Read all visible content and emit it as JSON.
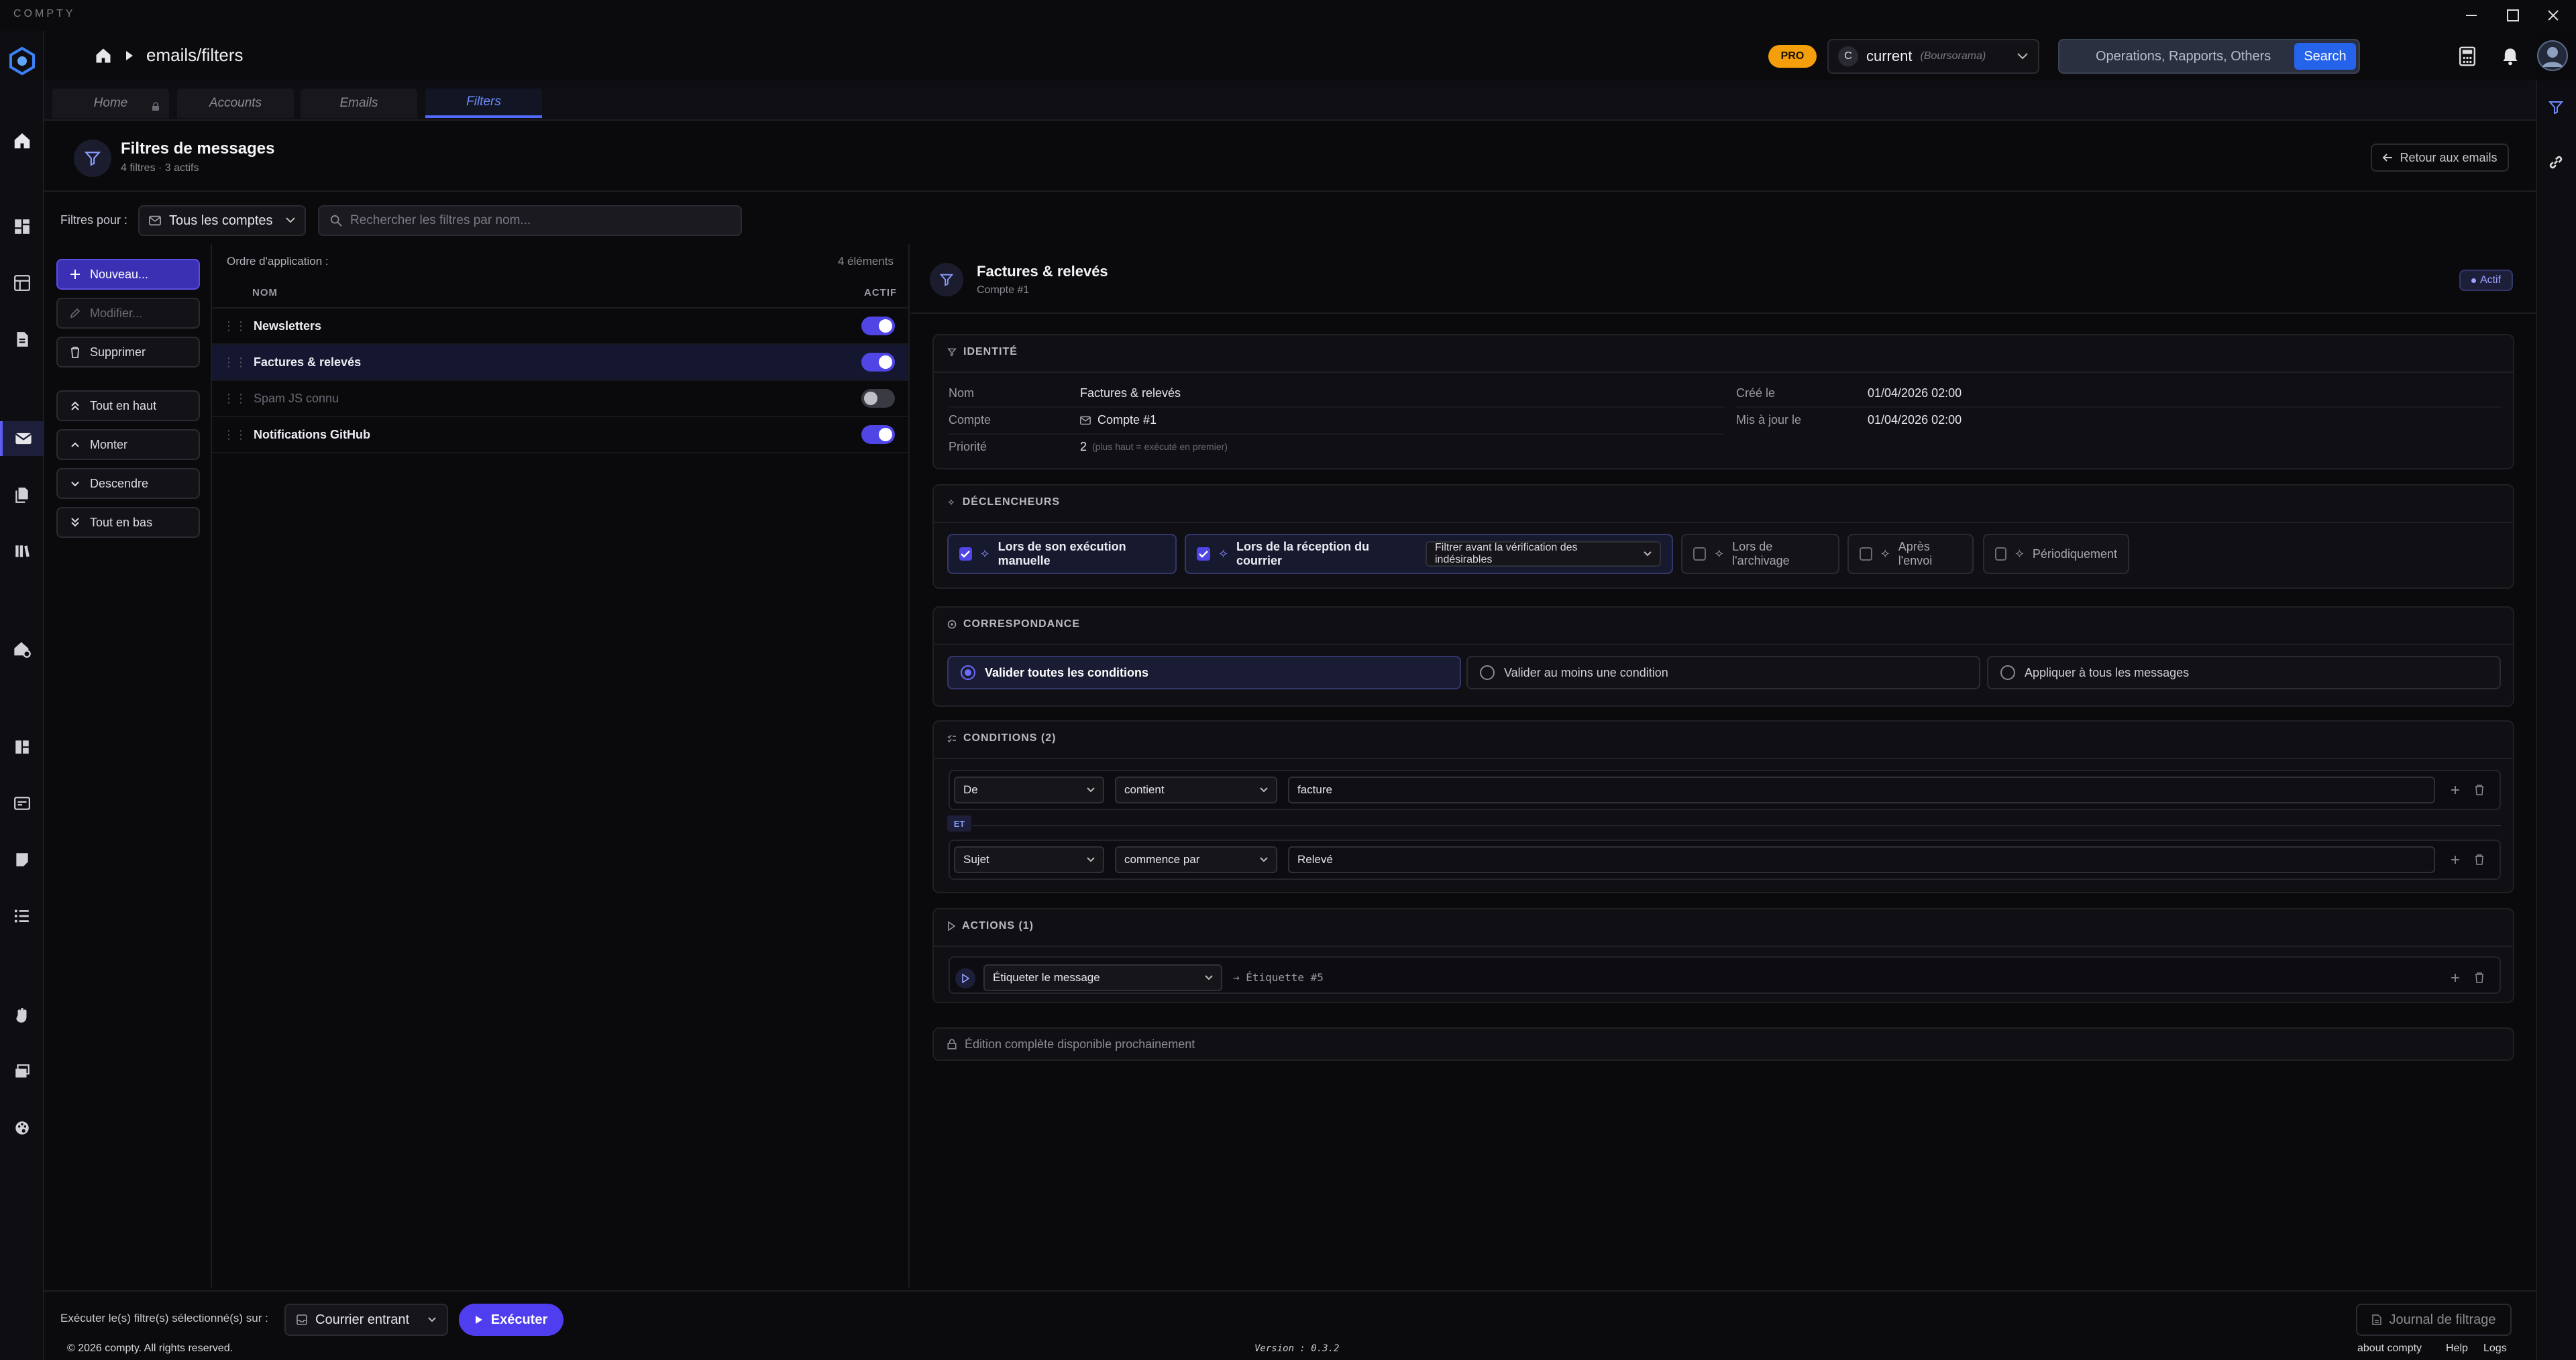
{
  "app": {
    "name": "COMPTY"
  },
  "header": {
    "breadcrumb": "emails/filters",
    "pro_badge": "PRO",
    "account_initial": "C",
    "account_name": "current",
    "account_sub": "(Boursorama)",
    "search_placeholder": "Operations, Rapports, Others",
    "search_button": "Search"
  },
  "tabs": [
    {
      "label": "Home"
    },
    {
      "label": "Accounts"
    },
    {
      "label": "Emails"
    },
    {
      "label": "Filters"
    }
  ],
  "page": {
    "title": "Filtres de messages",
    "subtitle": "4 filtres · 3 actifs",
    "back_button": "Retour aux emails"
  },
  "filterbar": {
    "label": "Filtres pour :",
    "account_select": "Tous les comptes",
    "search_placeholder": "Rechercher les filtres par nom..."
  },
  "actions": {
    "new": "Nouveau...",
    "edit": "Modifier...",
    "delete": "Supprimer",
    "top": "Tout en haut",
    "up": "Monter",
    "down": "Descendre",
    "bottom": "Tout en bas"
  },
  "list": {
    "order_label": "Ordre d'application :",
    "count": "4 éléments",
    "col_name": "NOM",
    "col_active": "ACTIF",
    "rows": [
      {
        "name": "Newsletters",
        "active": true
      },
      {
        "name": "Factures & relevés",
        "active": true
      },
      {
        "name": "Spam JS connu",
        "active": false
      },
      {
        "name": "Notifications GitHub",
        "active": true
      }
    ]
  },
  "detail": {
    "title": "Factures & relevés",
    "subtitle": "Compte #1",
    "status": "Actif",
    "identity": {
      "section": "IDENTITÉ",
      "name_label": "Nom",
      "name_value": "Factures & relevés",
      "account_label": "Compte",
      "account_value": "Compte #1",
      "priority_label": "Priorité",
      "priority_value": "2",
      "priority_hint": "(plus haut = exécuté en premier)",
      "created_label": "Créé le",
      "created_value": "01/04/2026 02:00",
      "updated_label": "Mis à jour le",
      "updated_value": "01/04/2026 02:00"
    },
    "triggers": {
      "section": "DÉCLENCHEURS",
      "manual": "Lors de son exécution manuelle",
      "receive": "Lors de la réception du courrier",
      "receive_option": "Filtrer avant la vérification des indésirables",
      "archive": "Lors de l'archivage",
      "send": "Après l'envoi",
      "periodic": "Périodiquement"
    },
    "matching": {
      "section": "CORRESPONDANCE",
      "all": "Valider toutes les conditions",
      "any": "Valider au moins une condition",
      "every": "Appliquer à tous les messages"
    },
    "conditions": {
      "section": "CONDITIONS (2)",
      "joiner": "ET",
      "items": [
        {
          "field": "De",
          "operator": "contient",
          "value": "facture"
        },
        {
          "field": "Sujet",
          "operator": "commence par",
          "value": "Relevé"
        }
      ]
    },
    "actions_section": {
      "section": "ACTIONS (1)",
      "action": "Étiqueter le message",
      "target": "→ Étiquette #5"
    },
    "notice": "Édition complète disponible prochainement"
  },
  "bottom": {
    "run_label": "Exécuter le(s) filtre(s) sélectionné(s) sur :",
    "run_select": "Courrier entrant",
    "run_button": "Exécuter",
    "log_button": "Journal de filtrage",
    "copyright": "© 2026 compty. All rights reserved.",
    "version": "Version : 0.3.2",
    "links": {
      "about": "about compty",
      "help": "Help",
      "logs": "Logs"
    }
  }
}
